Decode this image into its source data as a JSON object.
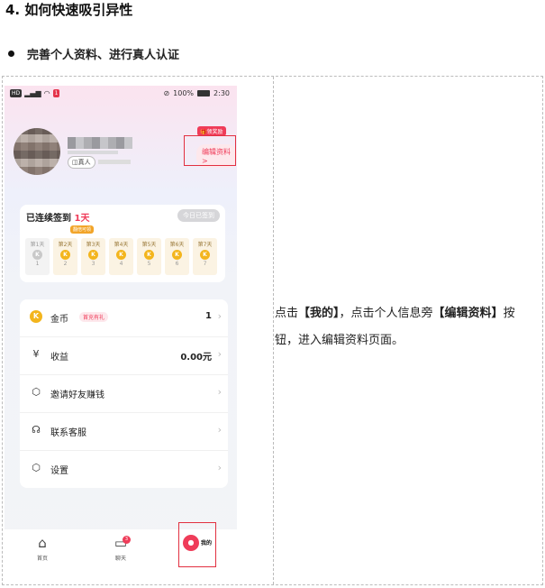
{
  "heading": "4.  如何快速吸引异性",
  "bullet": "完善个人资料、进行真人认证",
  "description": {
    "p1": "点击",
    "b1": "【我的】",
    "p2": "，点击个人信息旁",
    "b2": "【编辑资料】",
    "p3": "按钮，进入编辑资料页面。"
  },
  "phone": {
    "status": {
      "battery": "100%",
      "time": "2:30",
      "chip": "1"
    },
    "profile": {
      "real_badge": "真人",
      "reward_tag": "领奖励",
      "edit_button": "编辑资料 >"
    },
    "sign": {
      "title_prefix": "已连续签到",
      "days_count": "1天",
      "today_button": "今日已签到",
      "double_tag": "翻倍可领",
      "days": [
        {
          "label": "第1天",
          "n": "1"
        },
        {
          "label": "第2天",
          "n": "2"
        },
        {
          "label": "第3天",
          "n": "3"
        },
        {
          "label": "第4天",
          "n": "4"
        },
        {
          "label": "第5天",
          "n": "5"
        },
        {
          "label": "第6天",
          "n": "6"
        },
        {
          "label": "第7天",
          "n": "7"
        }
      ],
      "coin_glyph": "K"
    },
    "menu": [
      {
        "label": "金币",
        "tag": "首充有礼",
        "value": "1",
        "icon": "coin-icon"
      },
      {
        "label": "收益",
        "value": "0.00元",
        "icon": "earnings-icon"
      },
      {
        "label": "邀请好友赚钱",
        "icon": "invite-icon"
      },
      {
        "label": "联系客服",
        "icon": "headset-icon"
      },
      {
        "label": "设置",
        "icon": "settings-icon"
      }
    ],
    "tabs": [
      {
        "label": "首页"
      },
      {
        "label": "聊天",
        "badge": "3"
      },
      {
        "label": "我的"
      }
    ]
  }
}
